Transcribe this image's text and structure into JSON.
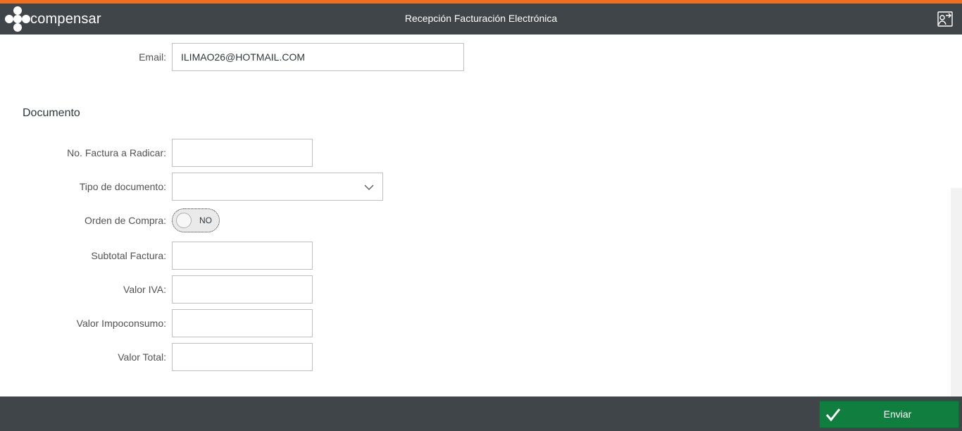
{
  "header": {
    "brand": "compensar",
    "title": "Recepción Facturación Electrónica",
    "logout_icon": "logout-icon"
  },
  "contact": {
    "email_label": "Email:",
    "email_value": "ILIMAO26@HOTMAIL.COM"
  },
  "documento": {
    "section_title": "Documento",
    "factura_label": "No. Factura a Radicar:",
    "factura_value": "",
    "tipo_label": "Tipo de documento:",
    "tipo_value": "",
    "orden_label": "Orden de Compra:",
    "orden_toggle": "NO",
    "subtotal_label": "Subtotal Factura:",
    "subtotal_value": "",
    "iva_label": "Valor IVA:",
    "iva_value": "",
    "impoconsumo_label": "Valor Impoconsumo:",
    "impoconsumo_value": "",
    "total_label": "Valor Total:",
    "total_value": ""
  },
  "footer": {
    "send_label": "Enviar"
  },
  "colors": {
    "accent": "#ef6f1f",
    "bar": "#3f4548",
    "send": "#107e3e"
  }
}
